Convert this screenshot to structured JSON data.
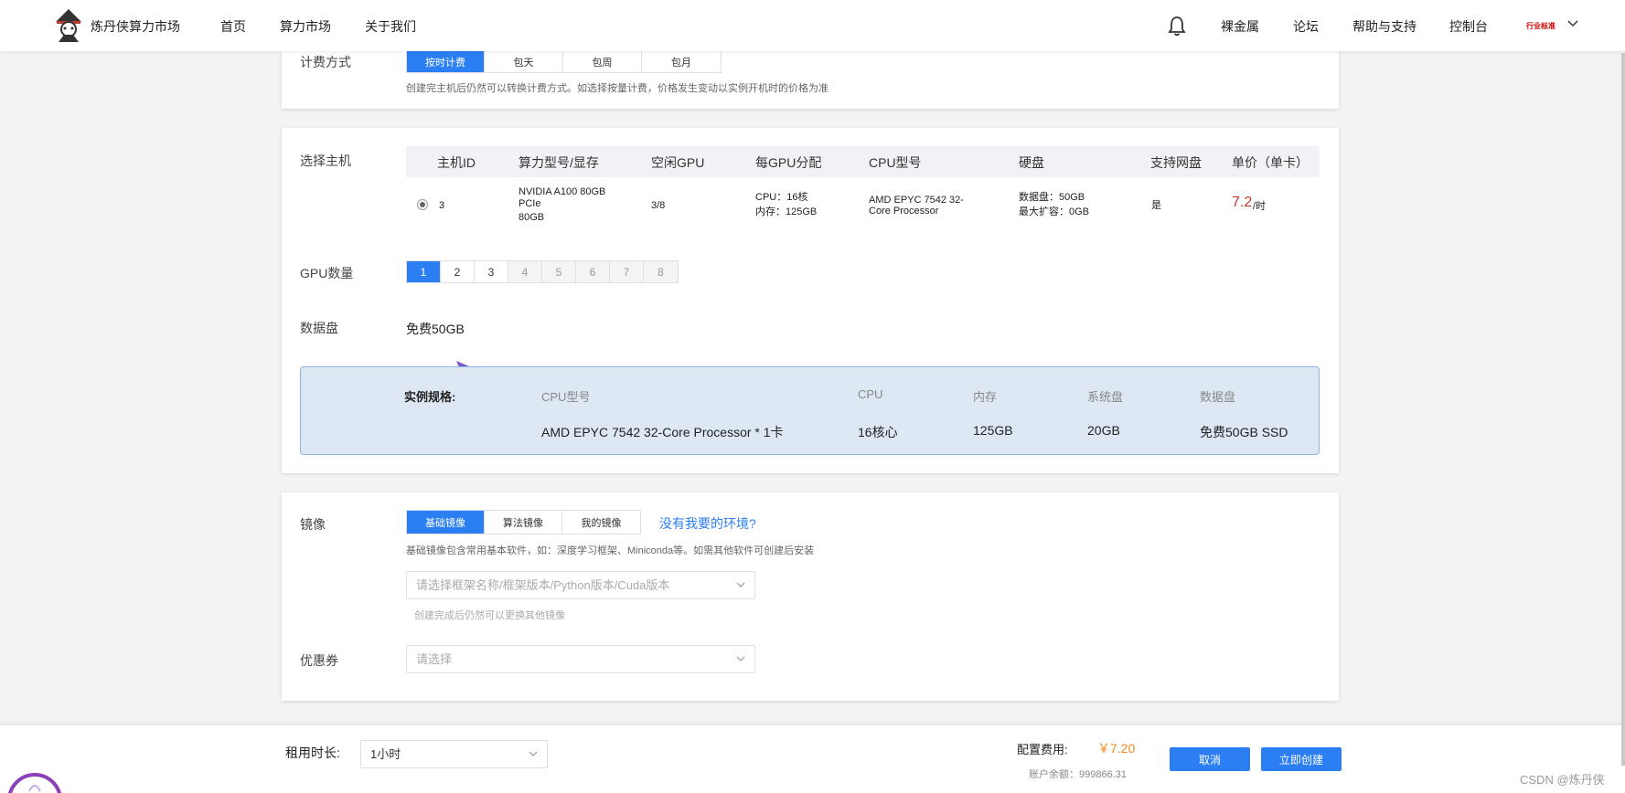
{
  "nav": {
    "brand": "炼丹侠算力市场",
    "links": [
      "首页",
      "算力市场",
      "关于我们"
    ],
    "right_links": [
      "裸金属",
      "论坛",
      "帮助与支持",
      "控制台"
    ],
    "badge_text": "行业标准"
  },
  "billing": {
    "label": "计费方式",
    "options": [
      "按时计费",
      "包天",
      "包周",
      "包月"
    ],
    "active": "按时计费",
    "hint": "创建完主机后仍然可以转换计费方式。如选择按量计费，价格发生变动以实例开机时的价格为准"
  },
  "host": {
    "label": "选择主机",
    "columns": [
      "主机ID",
      "算力型号/显存",
      "空闲GPU",
      "每GPU分配",
      "CPU型号",
      "硬盘",
      "支持网盘",
      "单价（单卡）"
    ],
    "row": {
      "id": "3",
      "gpu_model": "NVIDIA A100 80GB PCIe",
      "gpu_mem": "80GB",
      "free_gpu": "3/8",
      "cpu_alloc": "CPU：16核",
      "mem_alloc": "内存：125GB",
      "cpu_model_1": "AMD EPYC 7542 32-",
      "cpu_model_2": "Core Processor",
      "disk_1": "数据盘：50GB",
      "disk_2": "最大扩容：0GB",
      "netdisk": "是",
      "price": "7.2",
      "price_unit": "/时"
    }
  },
  "gpu_count": {
    "label": "GPU数量",
    "options": [
      "1",
      "2",
      "3",
      "4",
      "5",
      "6",
      "7",
      "8"
    ],
    "selected": "1",
    "available": 3
  },
  "data_disk": {
    "label": "数据盘",
    "value": "免费50GB"
  },
  "spec": {
    "title": "实例规格:",
    "headers": [
      "CPU型号",
      "CPU",
      "内存",
      "系统盘",
      "数据盘"
    ],
    "values": [
      "AMD EPYC 7542 32-Core Processor * 1卡",
      "16核心",
      "125GB",
      "20GB",
      "免费50GB SSD"
    ]
  },
  "image": {
    "label": "镜像",
    "tabs": [
      "基础镜像",
      "算法镜像",
      "我的镜像"
    ],
    "active": "基础镜像",
    "link": "没有我要的环境?",
    "hint": "基础镜像包含常用基本软件，如：深度学习框架、Miniconda等。如需其他软件可创建后安装",
    "placeholder": "请选择框架名称/框架版本/Python版本/Cuda版本",
    "sub_hint": "创建完成后仍然可以更换其他镜像"
  },
  "coupon": {
    "label": "优惠券",
    "placeholder": "请选择"
  },
  "footer": {
    "duration_label": "租用时长:",
    "duration_value": "1小时",
    "cost_label": "配置费用:",
    "cost_value": "￥7.20",
    "balance": "账户余额：999866.31",
    "cancel": "取消",
    "create": "立即创建",
    "watermark": "CSDN @炼丹侠"
  },
  "colors": {
    "primary": "#2b7ff2",
    "price_red": "#c0392b",
    "cost_orange": "#f08c1c",
    "spec_bg": "#dde8f4"
  }
}
